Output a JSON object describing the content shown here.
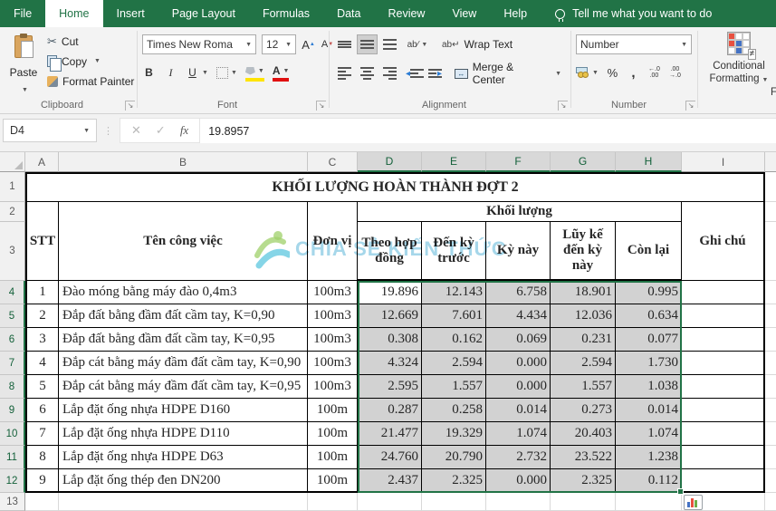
{
  "ribbon": {
    "tabs": [
      {
        "label": "File",
        "active": false
      },
      {
        "label": "Home",
        "active": true
      },
      {
        "label": "Insert",
        "active": false
      },
      {
        "label": "Page Layout",
        "active": false
      },
      {
        "label": "Formulas",
        "active": false
      },
      {
        "label": "Data",
        "active": false
      },
      {
        "label": "Review",
        "active": false
      },
      {
        "label": "View",
        "active": false
      },
      {
        "label": "Help",
        "active": false
      }
    ],
    "tell_me": "Tell me what you want to do",
    "groups": {
      "clipboard": {
        "label": "Clipboard",
        "paste": "Paste",
        "cut": "Cut",
        "copy": "Copy",
        "format_painter": "Format Painter"
      },
      "font": {
        "label": "Font",
        "font_name": "Times New Roma",
        "font_size": "12",
        "bold": "B",
        "italic": "I",
        "underline": "U"
      },
      "alignment": {
        "label": "Alignment",
        "wrap_text": "Wrap Text",
        "merge_center": "Merge & Center",
        "orientation": "ab"
      },
      "number": {
        "label": "Number",
        "format_selected": "Number",
        "percent": "%",
        "comma": ",",
        "inc_decimal": "←.0\n.00",
        "dec_decimal": ".00\n→.0"
      },
      "styles": {
        "conditional_line1": "Conditional",
        "conditional_line2": "Formatting",
        "clipped_next": "Fo"
      }
    }
  },
  "formula_bar": {
    "name_box": "D4",
    "fx": "fx",
    "cancel": "✕",
    "enter": "✓",
    "formula_value": "19.8957"
  },
  "sheet": {
    "columns": [
      {
        "label": "A",
        "selected": false
      },
      {
        "label": "B",
        "selected": false
      },
      {
        "label": "C",
        "selected": false
      },
      {
        "label": "D",
        "selected": true
      },
      {
        "label": "E",
        "selected": true
      },
      {
        "label": "F",
        "selected": true
      },
      {
        "label": "G",
        "selected": true
      },
      {
        "label": "H",
        "selected": true
      },
      {
        "label": "I",
        "selected": false
      }
    ],
    "rows": [
      {
        "label": "1",
        "selected": false
      },
      {
        "label": "2",
        "selected": false
      },
      {
        "label": "3",
        "selected": false
      },
      {
        "label": "4",
        "selected": true
      },
      {
        "label": "5",
        "selected": true
      },
      {
        "label": "6",
        "selected": true
      },
      {
        "label": "7",
        "selected": true
      },
      {
        "label": "8",
        "selected": true
      },
      {
        "label": "9",
        "selected": true
      },
      {
        "label": "10",
        "selected": true
      },
      {
        "label": "11",
        "selected": true
      },
      {
        "label": "12",
        "selected": true
      },
      {
        "label": "13",
        "selected": false
      }
    ],
    "title": "KHỐI LƯỢNG HOÀN THÀNH ĐỢT 2",
    "headers": {
      "stt": "STT",
      "task": "Tên công việc",
      "unit": "Đơn vị",
      "group": "Khối lượng",
      "col_d": "Theo hợp đồng",
      "col_e": "Đến kỳ trước",
      "col_f": "Kỳ này",
      "col_g": "Lũy kế đến kỳ này",
      "col_h": "Còn lại",
      "note": "Ghi chú"
    },
    "table_rows": [
      {
        "stt": "1",
        "task": "Đào móng bằng máy đào 0,4m3",
        "unit": "100m3",
        "values": [
          "19.896",
          "12.143",
          "6.758",
          "18.901",
          "0.995"
        ],
        "note": ""
      },
      {
        "stt": "2",
        "task": "Đắp đất bằng đầm đất cầm tay, K=0,90",
        "unit": "100m3",
        "values": [
          "12.669",
          "7.601",
          "4.434",
          "12.036",
          "0.634"
        ],
        "note": ""
      },
      {
        "stt": "3",
        "task": "Đắp đất bằng đầm đất cầm tay, K=0,95",
        "unit": "100m3",
        "values": [
          "0.308",
          "0.162",
          "0.069",
          "0.231",
          "0.077"
        ],
        "note": ""
      },
      {
        "stt": "4",
        "task": "Đắp cát bằng máy đầm đất cầm tay, K=0,90",
        "unit": "100m3",
        "values": [
          "4.324",
          "2.594",
          "0.000",
          "2.594",
          "1.730"
        ],
        "note": ""
      },
      {
        "stt": "5",
        "task": "Đắp cát bằng máy đầm đất cầm tay, K=0,95",
        "unit": "100m3",
        "values": [
          "2.595",
          "1.557",
          "0.000",
          "1.557",
          "1.038"
        ],
        "note": ""
      },
      {
        "stt": "6",
        "task": "Lắp đặt ống nhựa HDPE D160",
        "unit": "100m",
        "values": [
          "0.287",
          "0.258",
          "0.014",
          "0.273",
          "0.014"
        ],
        "note": ""
      },
      {
        "stt": "7",
        "task": "Lắp đặt ống nhựa HDPE D110",
        "unit": "100m",
        "values": [
          "21.477",
          "19.329",
          "1.074",
          "20.403",
          "1.074"
        ],
        "note": ""
      },
      {
        "stt": "8",
        "task": "Lắp đặt ống nhựa HDPE D63",
        "unit": "100m",
        "values": [
          "24.760",
          "20.790",
          "2.732",
          "23.522",
          "1.238"
        ],
        "note": ""
      },
      {
        "stt": "9",
        "task": "Lắp đặt ống thép đen DN200",
        "unit": "100m",
        "values": [
          "2.437",
          "2.325",
          "0.000",
          "2.325",
          "0.112"
        ],
        "note": ""
      }
    ],
    "selection": {
      "range": "D4:H12",
      "active_cell": "D4"
    }
  },
  "watermark": {
    "text": "CHIA SẺ KIẾN THỨC"
  },
  "colors": {
    "excel_green": "#217346",
    "selected_fill": "#d2d2d2",
    "header_selected_bg": "#d8d8d8",
    "grid_line": "#d9d9d9",
    "fill_swatch": "#ffe400",
    "font_color_swatch": "#e01010",
    "watermark_blue": "#a6d7ea"
  }
}
